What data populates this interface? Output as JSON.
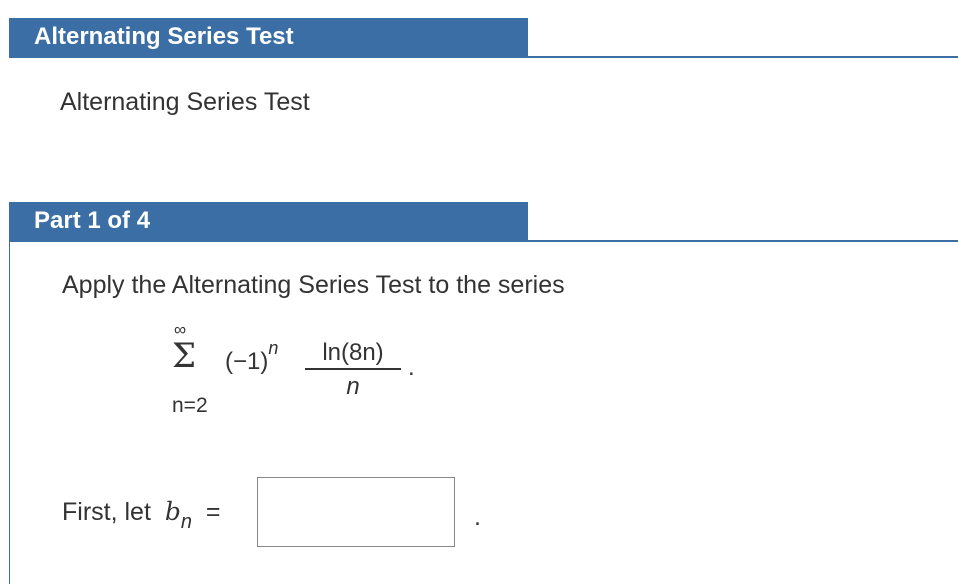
{
  "section": {
    "title": "Alternating Series Test",
    "intro": "Alternating Series Test"
  },
  "part": {
    "title": "Part 1 of 4",
    "prompt": "Apply the Alternating Series Test to the series",
    "series": {
      "upper_limit": "∞",
      "sigma": "Σ",
      "lower_limit": "n=2",
      "sign_base": "(−1)",
      "sign_exponent": "n",
      "numerator": "ln(8n)",
      "denominator": "n",
      "terminator": "."
    },
    "answer": {
      "label_prefix": "First, let",
      "variable": "b",
      "subscript": "n",
      "equals": "=",
      "value": "",
      "terminator": "."
    }
  },
  "colors": {
    "header_blue": "#3c6ea6",
    "text": "#333333"
  }
}
